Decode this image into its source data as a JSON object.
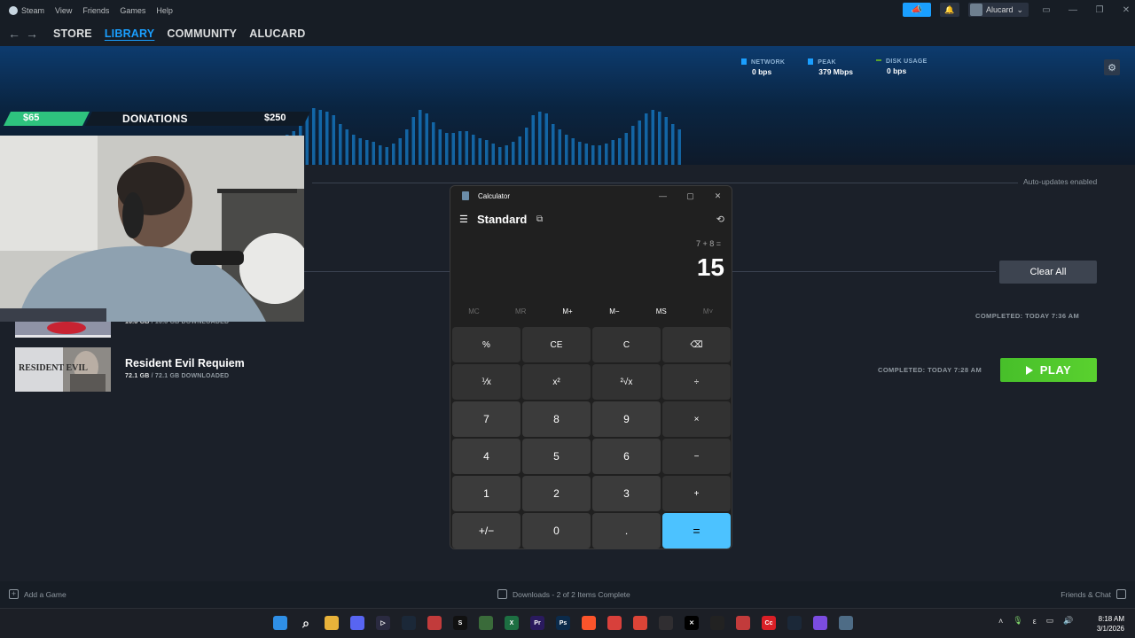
{
  "steam": {
    "menu": [
      "Steam",
      "View",
      "Friends",
      "Games",
      "Help"
    ],
    "user_name": "Alucard",
    "nav": [
      "STORE",
      "LIBRARY",
      "COMMUNITY",
      "ALUCARD"
    ],
    "active_nav": "LIBRARY"
  },
  "downloads": {
    "stats": [
      {
        "label": "NETWORK",
        "value": "0 bps",
        "color": "#1a9fff"
      },
      {
        "label": "PEAK",
        "value": "379 Mbps",
        "color": "#1a9fff"
      },
      {
        "label": "DISK USAGE",
        "value": "0 bps",
        "color": "#5ba32b"
      }
    ],
    "auto_updates": "Auto-updates enabled",
    "clear_all": "Clear All",
    "completed_1": "COMPLETED: TODAY 7:36 AM",
    "completed_2": "COMPLETED: TODAY 7:28 AM",
    "play_label": "PLAY",
    "games": [
      {
        "title": "",
        "size_done": "10.8 GB",
        "size_rest": "/ 10.8 GB DOWNLOADED"
      },
      {
        "title": "Resident Evil Requiem",
        "size_done": "72.1 GB",
        "size_rest": "/ 72.1 GB DOWNLOADED",
        "thumb_text": "RESIDENT EVIL"
      }
    ],
    "graph_accent": "#1a9fff"
  },
  "donations": {
    "current": "$65",
    "title": "DONATIONS",
    "goal": "$250",
    "progress": 0.26
  },
  "calculator": {
    "title": "Calculator",
    "mode": "Standard",
    "expression": "7 + 8 =",
    "result": "15",
    "memory": [
      "MC",
      "MR",
      "M+",
      "M−",
      "MS",
      "M˅"
    ],
    "memory_disabled": [
      true,
      true,
      false,
      false,
      false,
      true
    ],
    "keys": [
      "%",
      "CE",
      "C",
      "⌫",
      "⅟x",
      "x²",
      "²√x",
      "÷",
      "7",
      "8",
      "9",
      "×",
      "4",
      "5",
      "6",
      "−",
      "1",
      "2",
      "3",
      "+",
      "+/−",
      "0",
      ".",
      "="
    ],
    "equals_color": "#4cc2ff"
  },
  "bottom_bar": {
    "add_game": "Add a Game",
    "downloads_status": "Downloads - 2 of 2 Items Complete",
    "friends_chat": "Friends & Chat"
  },
  "taskbar": {
    "time": "8:18 AM",
    "date": "3/1/2026",
    "lang": "ε"
  }
}
